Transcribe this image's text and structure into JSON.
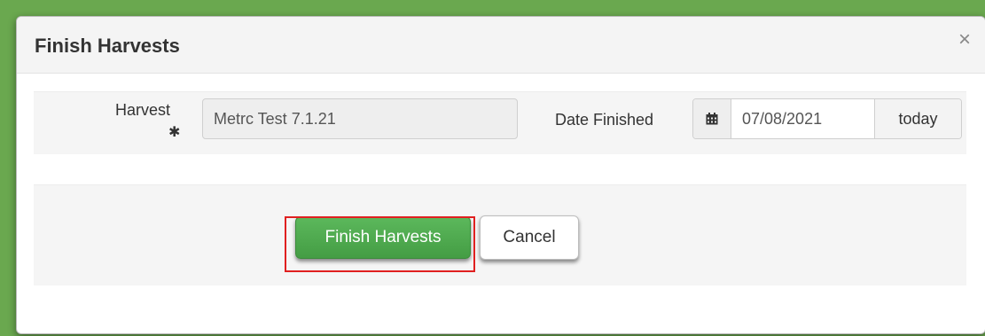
{
  "modal": {
    "title": "Finish Harvests",
    "close_icon": "close-icon",
    "close_glyph": "×"
  },
  "form": {
    "harvest_label": "Harvest",
    "required_glyph": "✱",
    "harvest_value": "Metrc Test 7.1.21",
    "date_label": "Date Finished",
    "calendar_icon": "calendar-icon",
    "date_value": "07/08/2021",
    "today_label": "today"
  },
  "footer": {
    "finish_label": "Finish Harvests",
    "cancel_label": "Cancel"
  },
  "colors": {
    "frame_green": "#6aa84f",
    "finish_button": "#5cb85c",
    "highlight": "#e02020"
  }
}
